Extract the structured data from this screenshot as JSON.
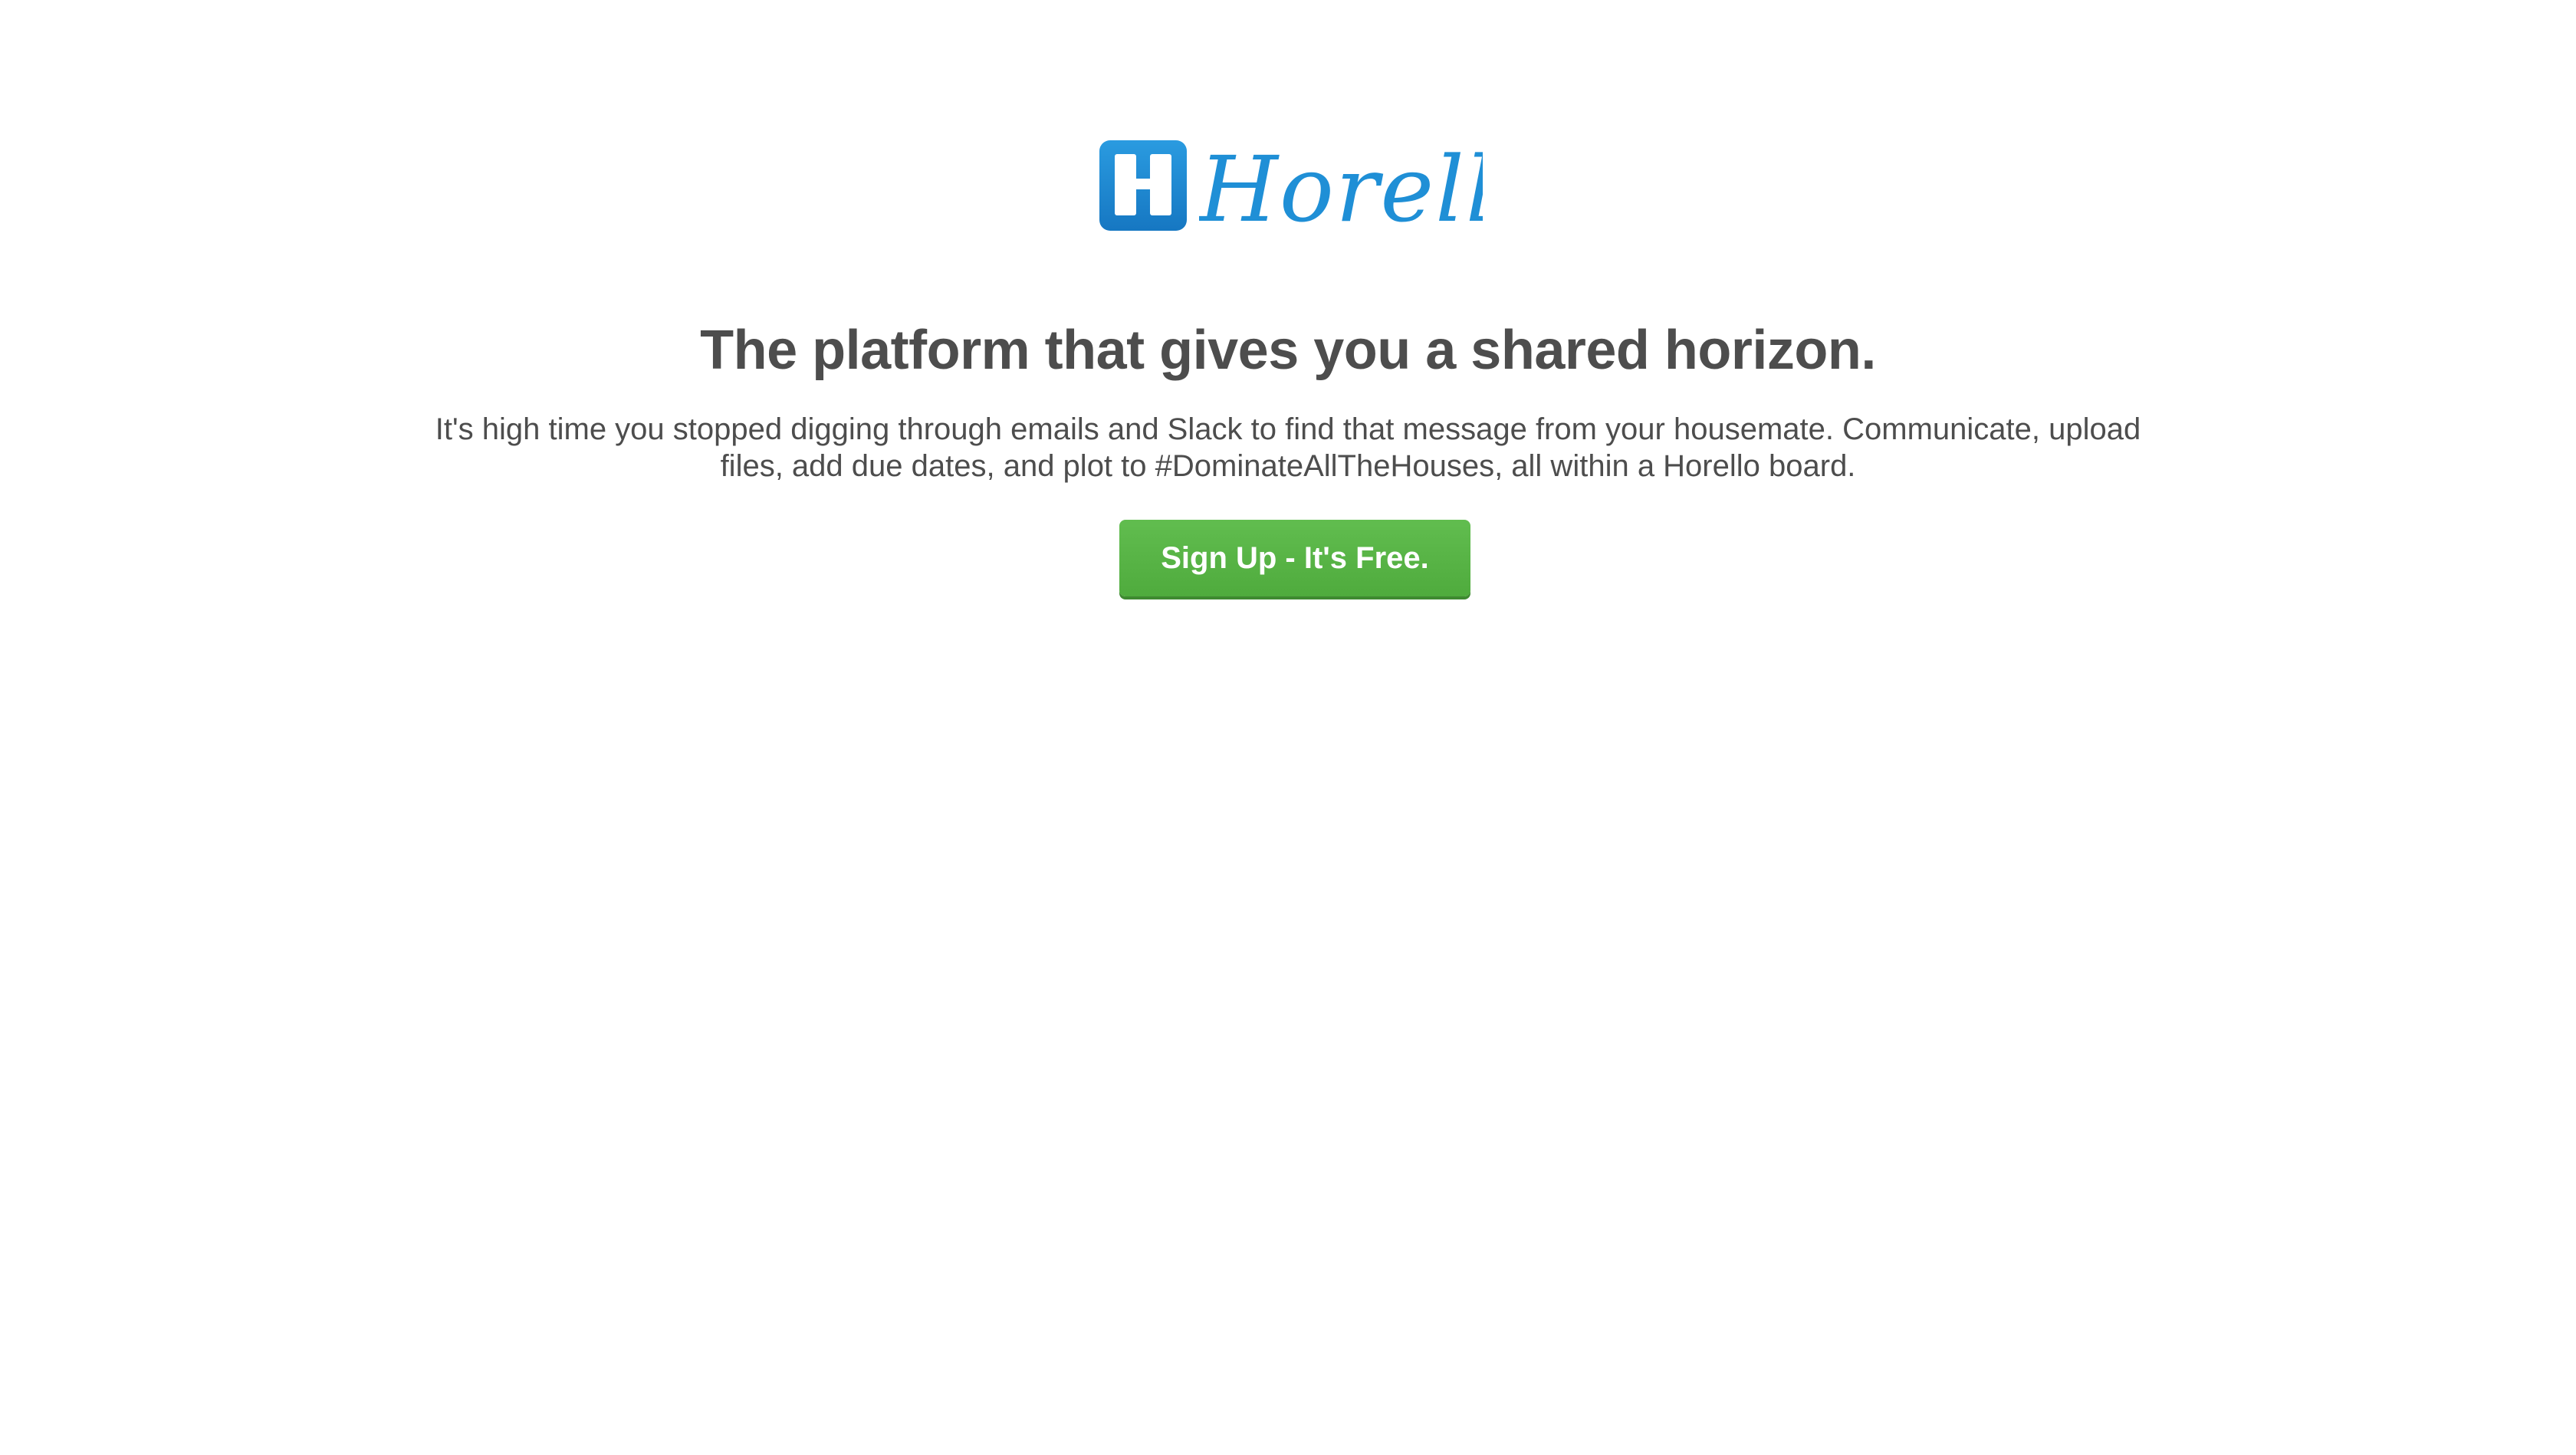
{
  "brand": {
    "name": "Horello",
    "logo_icon": "horello-board-icon",
    "color": "#1f8fd6"
  },
  "hero": {
    "headline": "The platform that gives you a shared horizon.",
    "description": "It's high time you stopped digging through emails and Slack to find that message from your housemate. Communicate, upload files, add due dates, and plot to #DominateAllTheHouses, all within a Horello board.",
    "cta_label": "Sign Up - It's Free.",
    "cta_color": "#5aac44"
  }
}
